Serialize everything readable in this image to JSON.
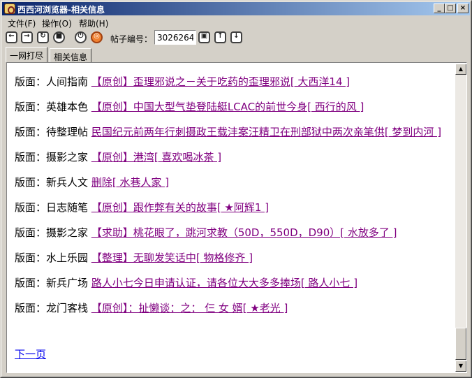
{
  "window": {
    "title": "西西河浏览器-相关信息",
    "controls": {
      "minimize": "_",
      "maximize": "□",
      "close": "×"
    }
  },
  "menu": [
    {
      "label": "文件(F)"
    },
    {
      "label": "操作(O)"
    },
    {
      "label": "帮助(H)"
    }
  ],
  "toolbar": {
    "buttons": [
      {
        "icon": "back-icon",
        "glyph": "←"
      },
      {
        "icon": "forward-icon",
        "glyph": "→"
      },
      {
        "icon": "refresh-icon",
        "glyph": "↻"
      },
      {
        "icon": "stop-icon",
        "glyph": "■"
      },
      {
        "icon": "power-icon",
        "glyph": "⏻"
      },
      {
        "icon": "swirl-icon",
        "glyph": "◎"
      },
      {
        "icon": "go-icon",
        "glyph": "▣"
      },
      {
        "icon": "page-up-icon",
        "glyph": "↑"
      },
      {
        "icon": "page-down-icon",
        "glyph": "↓"
      }
    ],
    "post_label": "帖子编号：",
    "post_value": "3026264"
  },
  "tabs": [
    {
      "label": "一网打尽",
      "active": true
    },
    {
      "label": "相关信息",
      "active": false
    }
  ],
  "posts": [
    {
      "board_label": "版面：",
      "board": "人间指南",
      "link": "【原创】歪理邪说之－关于吃药的歪理邪说[ 大西洋14 ]"
    },
    {
      "board_label": "版面：",
      "board": "英雄本色",
      "link": "【原创】中国大型气垫登陆艇LCAC的前世今身[ 西行的风 ]"
    },
    {
      "board_label": "版面：",
      "board": "待整理帖",
      "link": "民国纪元前两年行刺摄政王载沣案汪精卫在刑部狱中两次亲笔供[ 梦到内河 ]"
    },
    {
      "board_label": "版面：",
      "board": "摄影之家",
      "link": "【原创】港湾[ 喜欢喝冰茶 ]"
    },
    {
      "board_label": "版面：",
      "board": "新兵人文",
      "link": "删除[ 水巷人家 ]"
    },
    {
      "board_label": "版面：",
      "board": "日志随笔",
      "link": "【原创】跟作弊有关的故事[ ★阿辉1 ]"
    },
    {
      "board_label": "版面：",
      "board": "摄影之家",
      "link": "【求助】桃花眼了，跳河求教（50D，550D，D90）[ 水放多了 ]"
    },
    {
      "board_label": "版面：",
      "board": "水上乐园",
      "link": "【整理】无聊发笑话中[ 物格修齐 ]"
    },
    {
      "board_label": "版面：",
      "board": "新兵广场",
      "link": "路人小七今日申请认证，请各位大大多多捧场[ 路人小七 ]"
    },
    {
      "board_label": "版面：",
      "board": "龙门客栈",
      "link": "【原创】：扯懒谈：之： 仨 女 婿[ ★老光 ]"
    }
  ],
  "next_page": "下一页",
  "colors": {
    "title_gradient_start": "#0a246a",
    "title_gradient_end": "#a6caf0",
    "visited_link": "#800080",
    "link": "#0000ee",
    "chrome": "#d4d0c8"
  }
}
